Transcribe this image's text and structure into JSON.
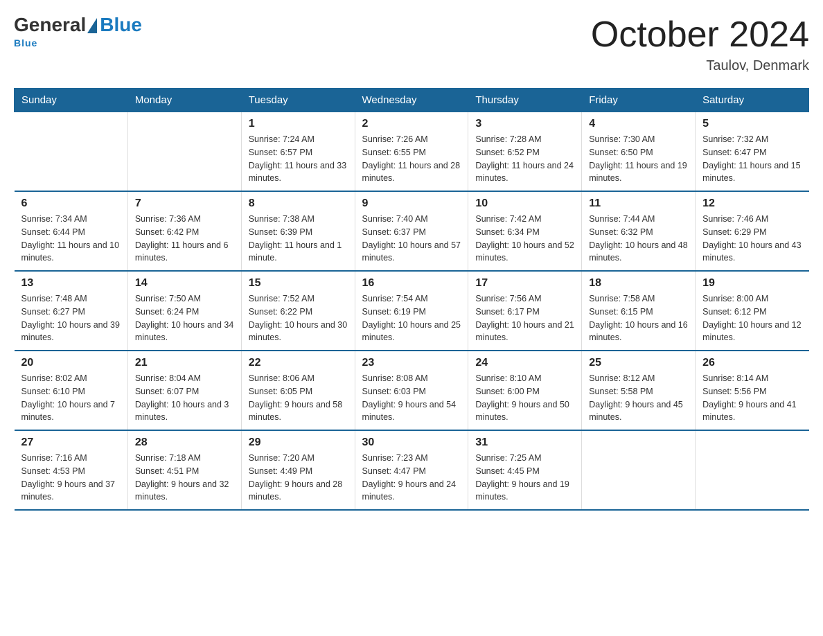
{
  "header": {
    "logo_general": "General",
    "logo_blue": "Blue",
    "month_title": "October 2024",
    "location": "Taulov, Denmark"
  },
  "days_of_week": [
    "Sunday",
    "Monday",
    "Tuesday",
    "Wednesday",
    "Thursday",
    "Friday",
    "Saturday"
  ],
  "weeks": [
    [
      {
        "day": "",
        "sunrise": "",
        "sunset": "",
        "daylight": ""
      },
      {
        "day": "",
        "sunrise": "",
        "sunset": "",
        "daylight": ""
      },
      {
        "day": "1",
        "sunrise": "Sunrise: 7:24 AM",
        "sunset": "Sunset: 6:57 PM",
        "daylight": "Daylight: 11 hours and 33 minutes."
      },
      {
        "day": "2",
        "sunrise": "Sunrise: 7:26 AM",
        "sunset": "Sunset: 6:55 PM",
        "daylight": "Daylight: 11 hours and 28 minutes."
      },
      {
        "day": "3",
        "sunrise": "Sunrise: 7:28 AM",
        "sunset": "Sunset: 6:52 PM",
        "daylight": "Daylight: 11 hours and 24 minutes."
      },
      {
        "day": "4",
        "sunrise": "Sunrise: 7:30 AM",
        "sunset": "Sunset: 6:50 PM",
        "daylight": "Daylight: 11 hours and 19 minutes."
      },
      {
        "day": "5",
        "sunrise": "Sunrise: 7:32 AM",
        "sunset": "Sunset: 6:47 PM",
        "daylight": "Daylight: 11 hours and 15 minutes."
      }
    ],
    [
      {
        "day": "6",
        "sunrise": "Sunrise: 7:34 AM",
        "sunset": "Sunset: 6:44 PM",
        "daylight": "Daylight: 11 hours and 10 minutes."
      },
      {
        "day": "7",
        "sunrise": "Sunrise: 7:36 AM",
        "sunset": "Sunset: 6:42 PM",
        "daylight": "Daylight: 11 hours and 6 minutes."
      },
      {
        "day": "8",
        "sunrise": "Sunrise: 7:38 AM",
        "sunset": "Sunset: 6:39 PM",
        "daylight": "Daylight: 11 hours and 1 minute."
      },
      {
        "day": "9",
        "sunrise": "Sunrise: 7:40 AM",
        "sunset": "Sunset: 6:37 PM",
        "daylight": "Daylight: 10 hours and 57 minutes."
      },
      {
        "day": "10",
        "sunrise": "Sunrise: 7:42 AM",
        "sunset": "Sunset: 6:34 PM",
        "daylight": "Daylight: 10 hours and 52 minutes."
      },
      {
        "day": "11",
        "sunrise": "Sunrise: 7:44 AM",
        "sunset": "Sunset: 6:32 PM",
        "daylight": "Daylight: 10 hours and 48 minutes."
      },
      {
        "day": "12",
        "sunrise": "Sunrise: 7:46 AM",
        "sunset": "Sunset: 6:29 PM",
        "daylight": "Daylight: 10 hours and 43 minutes."
      }
    ],
    [
      {
        "day": "13",
        "sunrise": "Sunrise: 7:48 AM",
        "sunset": "Sunset: 6:27 PM",
        "daylight": "Daylight: 10 hours and 39 minutes."
      },
      {
        "day": "14",
        "sunrise": "Sunrise: 7:50 AM",
        "sunset": "Sunset: 6:24 PM",
        "daylight": "Daylight: 10 hours and 34 minutes."
      },
      {
        "day": "15",
        "sunrise": "Sunrise: 7:52 AM",
        "sunset": "Sunset: 6:22 PM",
        "daylight": "Daylight: 10 hours and 30 minutes."
      },
      {
        "day": "16",
        "sunrise": "Sunrise: 7:54 AM",
        "sunset": "Sunset: 6:19 PM",
        "daylight": "Daylight: 10 hours and 25 minutes."
      },
      {
        "day": "17",
        "sunrise": "Sunrise: 7:56 AM",
        "sunset": "Sunset: 6:17 PM",
        "daylight": "Daylight: 10 hours and 21 minutes."
      },
      {
        "day": "18",
        "sunrise": "Sunrise: 7:58 AM",
        "sunset": "Sunset: 6:15 PM",
        "daylight": "Daylight: 10 hours and 16 minutes."
      },
      {
        "day": "19",
        "sunrise": "Sunrise: 8:00 AM",
        "sunset": "Sunset: 6:12 PM",
        "daylight": "Daylight: 10 hours and 12 minutes."
      }
    ],
    [
      {
        "day": "20",
        "sunrise": "Sunrise: 8:02 AM",
        "sunset": "Sunset: 6:10 PM",
        "daylight": "Daylight: 10 hours and 7 minutes."
      },
      {
        "day": "21",
        "sunrise": "Sunrise: 8:04 AM",
        "sunset": "Sunset: 6:07 PM",
        "daylight": "Daylight: 10 hours and 3 minutes."
      },
      {
        "day": "22",
        "sunrise": "Sunrise: 8:06 AM",
        "sunset": "Sunset: 6:05 PM",
        "daylight": "Daylight: 9 hours and 58 minutes."
      },
      {
        "day": "23",
        "sunrise": "Sunrise: 8:08 AM",
        "sunset": "Sunset: 6:03 PM",
        "daylight": "Daylight: 9 hours and 54 minutes."
      },
      {
        "day": "24",
        "sunrise": "Sunrise: 8:10 AM",
        "sunset": "Sunset: 6:00 PM",
        "daylight": "Daylight: 9 hours and 50 minutes."
      },
      {
        "day": "25",
        "sunrise": "Sunrise: 8:12 AM",
        "sunset": "Sunset: 5:58 PM",
        "daylight": "Daylight: 9 hours and 45 minutes."
      },
      {
        "day": "26",
        "sunrise": "Sunrise: 8:14 AM",
        "sunset": "Sunset: 5:56 PM",
        "daylight": "Daylight: 9 hours and 41 minutes."
      }
    ],
    [
      {
        "day": "27",
        "sunrise": "Sunrise: 7:16 AM",
        "sunset": "Sunset: 4:53 PM",
        "daylight": "Daylight: 9 hours and 37 minutes."
      },
      {
        "day": "28",
        "sunrise": "Sunrise: 7:18 AM",
        "sunset": "Sunset: 4:51 PM",
        "daylight": "Daylight: 9 hours and 32 minutes."
      },
      {
        "day": "29",
        "sunrise": "Sunrise: 7:20 AM",
        "sunset": "Sunset: 4:49 PM",
        "daylight": "Daylight: 9 hours and 28 minutes."
      },
      {
        "day": "30",
        "sunrise": "Sunrise: 7:23 AM",
        "sunset": "Sunset: 4:47 PM",
        "daylight": "Daylight: 9 hours and 24 minutes."
      },
      {
        "day": "31",
        "sunrise": "Sunrise: 7:25 AM",
        "sunset": "Sunset: 4:45 PM",
        "daylight": "Daylight: 9 hours and 19 minutes."
      },
      {
        "day": "",
        "sunrise": "",
        "sunset": "",
        "daylight": ""
      },
      {
        "day": "",
        "sunrise": "",
        "sunset": "",
        "daylight": ""
      }
    ]
  ]
}
